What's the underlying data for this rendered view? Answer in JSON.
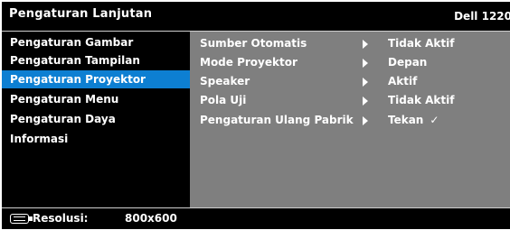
{
  "header": {
    "title": "Pengaturan Lanjutan",
    "model": "Dell 1220"
  },
  "sidebar": {
    "items": [
      {
        "label": "Pengaturan Gambar",
        "active": false
      },
      {
        "label": "Pengaturan Tampilan",
        "active": false
      },
      {
        "label": "Pengaturan Proyektor",
        "active": true
      },
      {
        "label": "Pengaturan Menu",
        "active": false
      },
      {
        "label": "Pengaturan Daya",
        "active": false
      },
      {
        "label": "Informasi",
        "active": false
      }
    ]
  },
  "panel": {
    "rows": [
      {
        "label": "Sumber Otomatis",
        "value": "Tidak Aktif"
      },
      {
        "label": "Mode Proyektor",
        "value": "Depan"
      },
      {
        "label": "Speaker",
        "value": "Aktif"
      },
      {
        "label": "Pola Uji",
        "value": "Tidak Aktif"
      },
      {
        "label": "Pengaturan Ulang Pabrik",
        "value": "Tekan",
        "check": "✓"
      }
    ]
  },
  "footer": {
    "icon": "display-icon",
    "resolution_label": "Resolusi:",
    "resolution_value": "800x600"
  },
  "colors": {
    "background": "#000000",
    "active_item": "#0d7fd2",
    "panel": "#7f7f7f",
    "text": "#ffffff"
  }
}
